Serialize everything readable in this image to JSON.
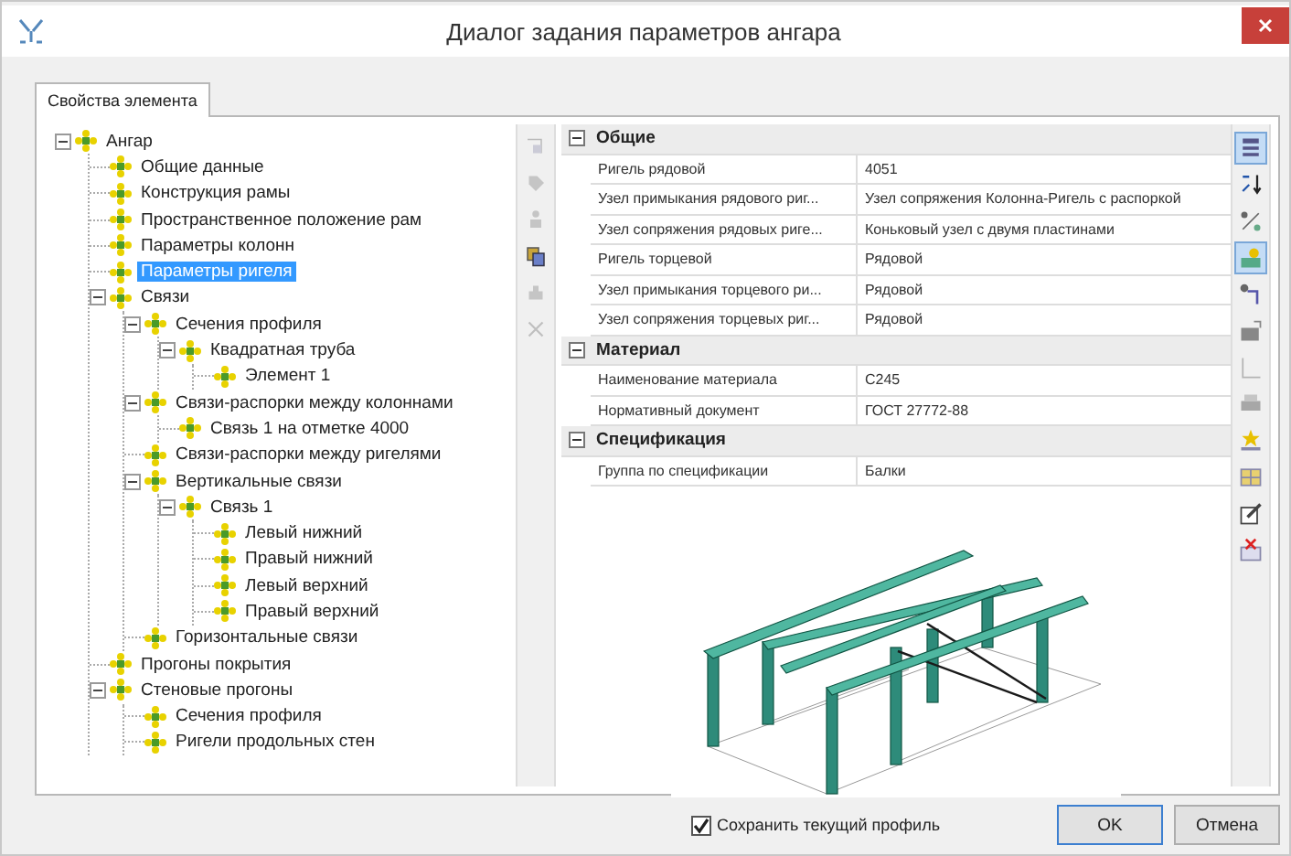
{
  "window": {
    "title": "Диалог задания параметров ангара"
  },
  "tabs": [
    {
      "label": "Свойства элемента",
      "selected": true
    }
  ],
  "tree": [
    {
      "label": "Ангар",
      "selected": false,
      "expanded": true,
      "children": [
        {
          "label": "Общие данные",
          "selected": false
        },
        {
          "label": "Конструкция рамы",
          "selected": false
        },
        {
          "label": "Пространственное положение рам",
          "selected": false
        },
        {
          "label": "Параметры колонн",
          "selected": false
        },
        {
          "label": "Параметры ригеля",
          "selected": true
        },
        {
          "label": "Связи",
          "selected": false,
          "expanded": true,
          "children": [
            {
              "label": "Сечения профиля",
              "selected": false,
              "expanded": true,
              "children": [
                {
                  "label": "Квадратная труба",
                  "selected": false,
                  "expanded": true,
                  "children": [
                    {
                      "label": "Элемент 1",
                      "selected": false
                    }
                  ]
                }
              ]
            },
            {
              "label": "Связи-распорки между колоннами",
              "selected": false,
              "expanded": true,
              "children": [
                {
                  "label": "Связь 1 на отметке 4000",
                  "selected": false
                }
              ]
            },
            {
              "label": "Связи-распорки между ригелями",
              "selected": false
            },
            {
              "label": "Вертикальные связи",
              "selected": false,
              "expanded": true,
              "children": [
                {
                  "label": "Связь 1",
                  "selected": false,
                  "expanded": true,
                  "children": [
                    {
                      "label": "Левый нижний",
                      "selected": false
                    },
                    {
                      "label": "Правый нижний",
                      "selected": false
                    },
                    {
                      "label": "Левый верхний",
                      "selected": false
                    },
                    {
                      "label": "Правый верхний",
                      "selected": false
                    }
                  ]
                }
              ]
            },
            {
              "label": "Горизонтальные связи",
              "selected": false
            }
          ]
        },
        {
          "label": "Прогоны покрытия",
          "selected": false
        },
        {
          "label": "Стеновые прогоны",
          "selected": false,
          "expanded": true,
          "children": [
            {
              "label": "Сечения профиля",
              "selected": false
            },
            {
              "label": "Ригели продольных стен",
              "selected": false
            }
          ]
        }
      ]
    }
  ],
  "left_toolbar": [
    {
      "disabled": true
    },
    {
      "disabled": true
    },
    {
      "disabled": true
    },
    {
      "disabled": false
    },
    {
      "disabled": true
    },
    {
      "disabled": true
    }
  ],
  "property_grid": [
    {
      "category": "Общие",
      "expanded": true,
      "rows": [
        {
          "name": "Ригель рядовой",
          "value": "4051"
        },
        {
          "name": "Узел примыкания рядового риг...",
          "value": "Узел сопряжения Колонна-Ригель с распоркой"
        },
        {
          "name": "Узел сопряжения рядовых риге...",
          "value": "Коньковый узел с двумя пластинами"
        },
        {
          "name": "Ригель торцевой",
          "value": "Рядовой"
        },
        {
          "name": "Узел примыкания торцевого ри...",
          "value": "Рядовой"
        },
        {
          "name": "Узел сопряжения торцевых риг...",
          "value": "Рядовой"
        }
      ]
    },
    {
      "category": "Материал",
      "expanded": true,
      "rows": [
        {
          "name": "Наименование материала",
          "value": "С245"
        },
        {
          "name": "Нормативный документ",
          "value": "ГОСТ 27772-88"
        }
      ]
    },
    {
      "category": "Спецификация",
      "expanded": true,
      "rows": [
        {
          "name": "Группа по спецификации",
          "value": "Балки"
        }
      ]
    }
  ],
  "right_toolbar": [
    {
      "selected": true
    },
    {
      "selected": false
    },
    {
      "selected": false
    },
    {
      "selected": true
    },
    {
      "selected": false
    },
    {
      "selected": false
    },
    {
      "selected": false
    },
    {
      "selected": false
    },
    {
      "selected": false
    },
    {
      "selected": false
    },
    {
      "selected": false
    },
    {
      "selected": false
    }
  ],
  "footer": {
    "save_profile": {
      "label": "Сохранить текущий профиль",
      "checked": true
    },
    "buttons": [
      {
        "label": "OK",
        "default": true
      },
      {
        "label": "Отмена",
        "default": false
      }
    ]
  }
}
